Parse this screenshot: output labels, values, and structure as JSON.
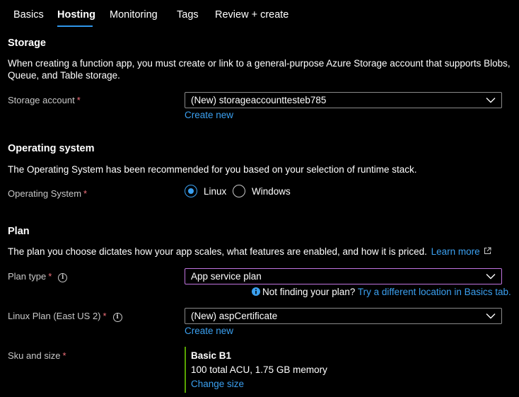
{
  "tabs": [
    {
      "label": "Basics"
    },
    {
      "label": "Hosting"
    },
    {
      "label": "Monitoring"
    },
    {
      "label": "Tags"
    },
    {
      "label": "Review + create"
    }
  ],
  "storage": {
    "heading": "Storage",
    "description": "When creating a function app, you must create or link to a general-purpose Azure Storage account that supports Blobs, Queue, and Table storage.",
    "account_label": "Storage account",
    "account_value": "(New) storageaccounttesteb785",
    "create_new": "Create new"
  },
  "os": {
    "heading": "Operating system",
    "description": "The Operating System has been recommended for you based on your selection of runtime stack.",
    "label": "Operating System",
    "options": [
      "Linux",
      "Windows"
    ],
    "selected": "Linux"
  },
  "plan": {
    "heading": "Plan",
    "description": "The plan you choose dictates how your app scales, what features are enabled, and how it is priced.",
    "learn_more": "Learn more",
    "type_label": "Plan type",
    "type_value": "App service plan",
    "not_finding": "Not finding your plan?",
    "try_location": "Try a different location in Basics tab.",
    "linux_plan_label": "Linux Plan (East US 2)",
    "linux_plan_value": "(New) aspCertificate",
    "create_new": "Create new",
    "sku_label": "Sku and size",
    "sku_name": "Basic B1",
    "sku_detail": "100 total ACU, 1.75 GB memory",
    "change_size": "Change size"
  },
  "required_marker": "*",
  "colors": {
    "background": "#000000",
    "accent": "#2f96e9",
    "link": "#3ba0f0",
    "required": "#f1707b",
    "focus_border": "#c174e0",
    "sku_bar": "#57a300"
  }
}
